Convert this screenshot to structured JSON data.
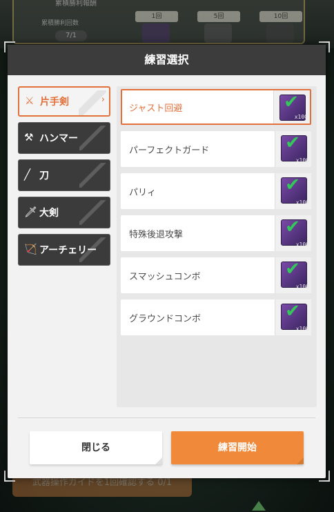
{
  "background": {
    "panel_title": "累積勝利報酬",
    "count_label": "累積勝利回数",
    "count_value": "7/1",
    "tabs": [
      "1回",
      "5回",
      "10回"
    ],
    "bottom_button": "武器操作ガイドを1回確認する 0/1"
  },
  "dialog": {
    "title": "練習選択",
    "categories": [
      {
        "label": "片手剣",
        "icon": "sword-and-shield-icon",
        "selected": true
      },
      {
        "label": "ハンマー",
        "icon": "hammer-icon",
        "selected": false
      },
      {
        "label": "刀",
        "icon": "katana-icon",
        "selected": false
      },
      {
        "label": "大剣",
        "icon": "greatsword-icon",
        "selected": false
      },
      {
        "label": "アーチェリー",
        "icon": "bow-icon",
        "selected": false
      }
    ],
    "practices": [
      {
        "label": "ジャスト回避",
        "quantity": "x100",
        "checked": true,
        "selected": true
      },
      {
        "label": "パーフェクトガード",
        "quantity": "x100",
        "checked": true,
        "selected": false
      },
      {
        "label": "パリィ",
        "quantity": "x100",
        "checked": true,
        "selected": false
      },
      {
        "label": "特殊後退攻撃",
        "quantity": "x100",
        "checked": true,
        "selected": false
      },
      {
        "label": "スマッシュコンボ",
        "quantity": "x100",
        "checked": true,
        "selected": false
      },
      {
        "label": "グラウンドコンボ",
        "quantity": "x100",
        "checked": true,
        "selected": false
      }
    ],
    "close_button": "閉じる",
    "start_button": "練習開始"
  },
  "colors": {
    "accent": "#e36f3a",
    "start_button": "#f08a3a",
    "header": "#3c3c3c",
    "check": "#34c759",
    "gem": "#7a4aa8"
  }
}
